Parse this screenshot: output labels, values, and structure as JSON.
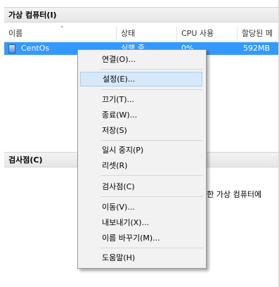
{
  "vm_section": {
    "title": "가상 컴퓨터(I)",
    "columns": [
      "이름",
      "상태",
      "CPU 사용",
      "할당된 메"
    ],
    "rows": [
      {
        "name": "CentOs",
        "state": "실행 중",
        "cpu": "0%",
        "memory": "592MB"
      }
    ]
  },
  "checkpoint_section": {
    "title": "검사점(C)",
    "message": "선택한 가상 컴퓨터에"
  },
  "context_menu": {
    "items": [
      "연결(O)...",
      "설정(E)...",
      "끄기(T)...",
      "종료(W)...",
      "저장(S)",
      "일시 중지(P)",
      "리셋(R)",
      "검사점(C)",
      "이동(V)...",
      "내보내기(X)...",
      "이름 바꾸기(M)...",
      "도움말(H)"
    ],
    "highlighted": "설정(E)...",
    "colors": {
      "highlight": "#d6e8fa",
      "selection": "#3399ff"
    }
  }
}
